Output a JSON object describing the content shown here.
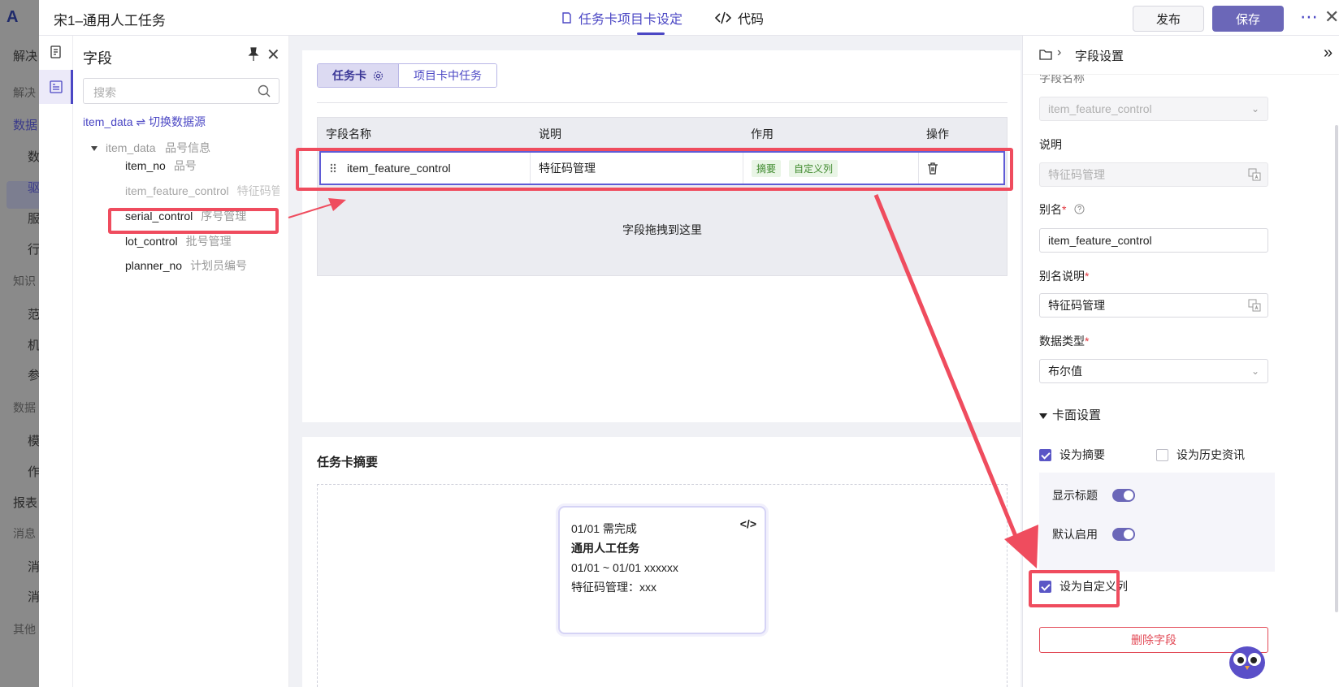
{
  "bg_nav": {
    "logo": "A",
    "items": [
      "解决",
      "数据",
      "数",
      "驱",
      "服",
      "行",
      "知识",
      "范",
      "机",
      "参",
      "数据",
      "模",
      "作",
      "报表",
      "消息",
      "消",
      "消",
      "其他"
    ]
  },
  "header": {
    "title": "宋1–通用人工任务",
    "tab_settings": "任务卡项目卡设定",
    "tab_code": "代码",
    "publish": "发布",
    "save": "保存",
    "more": "⋯",
    "close": "✕"
  },
  "field_panel": {
    "title": "字段",
    "close": "✕",
    "search_placeholder": "搜索",
    "source": "item_data ⇌ 切换数据源",
    "tree_root_name": "item_data",
    "tree_root_desc": "品号信息",
    "items": [
      {
        "name": "item_no",
        "desc": "品号"
      },
      {
        "name": "item_feature_control",
        "desc": "特征码管理"
      },
      {
        "name": "serial_control",
        "desc": "序号管理"
      },
      {
        "name": "lot_control",
        "desc": "批号管理"
      },
      {
        "name": "planner_no",
        "desc": "计划员编号"
      }
    ]
  },
  "main": {
    "seg_task": "任务卡",
    "seg_project": "项目卡中任务",
    "columns": [
      "字段名称",
      "说明",
      "作用",
      "操作"
    ],
    "row": {
      "name": "item_feature_control",
      "desc": "特征码管理",
      "tags": [
        "摘要",
        "自定义列"
      ]
    },
    "drop_hint": "字段拖拽到这里",
    "summary_title": "任务卡摘要",
    "preview": {
      "line1": "01/01 需完成",
      "line2": "通用人工任务",
      "line3": "01/01 ~ 01/01 xxxxxx",
      "line4": "特征码管理：xxx",
      "code_icon": "</>"
    }
  },
  "right_panel": {
    "title": "字段设置",
    "field_name_label": "字段名称",
    "field_name_value": "item_feature_control",
    "desc_label": "说明",
    "desc_value": "特征码管理",
    "alias_label": "别名",
    "alias_value": "item_feature_control",
    "alias_desc_label": "别名说明",
    "alias_desc_value": "特征码管理",
    "data_type_label": "数据类型",
    "data_type_value": "布尔值",
    "required_mark": "*",
    "card_settings": "卡面设置",
    "set_summary": "设为摘要",
    "set_history": "设为历史资讯",
    "show_title": "显示标题",
    "default_enable": "默认启用",
    "set_custom_column": "设为自定义列",
    "delete_field": "删除字段"
  },
  "colors": {
    "accent": "#4b47c4",
    "save_button": "#6b67b8",
    "annotation_red": "#ef4c5e",
    "tag_green_bg": "#e9f5e6",
    "tag_green_text": "#3f8a2e"
  }
}
